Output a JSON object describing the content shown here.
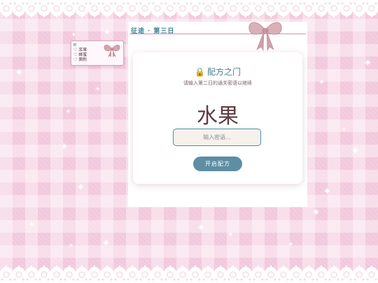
{
  "panel": {
    "title": "征途 · 第三日"
  },
  "note_card": {
    "marker": "≡",
    "lines": [
      "♡ 浆果",
      "♡ 蜂蜜",
      "♡ 面粉"
    ],
    "line_suffix": "3"
  },
  "card": {
    "heading": "配方之门",
    "subtitle": "请输入第二日的通关密语以继续",
    "clue": "水果",
    "input": {
      "placeholder": "输入密语...",
      "value": ""
    },
    "button_label": "开启配方"
  },
  "icons": {
    "lock": "lock-icon",
    "bow": "ribbon-bow-icon",
    "sparkle": "sparkle-icon",
    "lace": "lace-border"
  },
  "colors": {
    "background_pink": "#f2c9dc",
    "accent_teal": "#4f8ba5",
    "button": "#5d8ea3",
    "clue_text": "#5e3b43",
    "bow": "#d4a3ad"
  }
}
